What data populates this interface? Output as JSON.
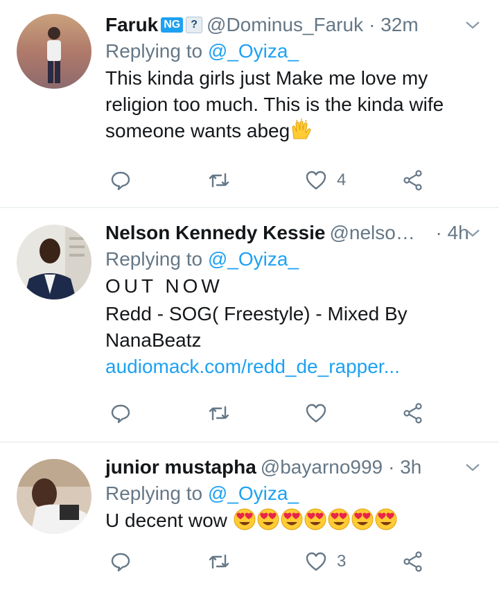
{
  "tweets": [
    {
      "name": "Faruk",
      "badges": [
        "NG",
        "?"
      ],
      "handle": "@Dominus_Faruk",
      "time": "· 32m",
      "replying_label": "Replying to",
      "replying_to": "@_Oyiza_",
      "text": "This kinda girls just Make me love my religion too much. This is the kinda wife someone wants abeg",
      "like_count": "4"
    },
    {
      "name": "Nelson Kennedy Kessie",
      "handle": "@nelsonkessie",
      "time": "· 4h",
      "replying_label": "Replying to",
      "replying_to": "@_Oyiza_",
      "text_line1": "OUT NOW",
      "text_line2": "Redd - SOG( Freestyle) - Mixed By NanaBeatz",
      "link": "audiomack.com/redd_de_rapper...",
      "like_count": ""
    },
    {
      "name": "junior mustapha",
      "handle": "@bayarno999",
      "time": "· 3h",
      "replying_label": "Replying to",
      "replying_to": "@_Oyiza_",
      "text": "U decent wow",
      "like_count": "3"
    }
  ],
  "colors": {
    "link": "#1da1f2",
    "muted": "#657786",
    "text": "#14171a",
    "divider": "#e1e8ed"
  },
  "icons": [
    "reply-icon",
    "retweet-icon",
    "like-icon",
    "share-icon",
    "chevron-down-icon",
    "raised-hands-emoji",
    "heart-eyes-emoji"
  ]
}
